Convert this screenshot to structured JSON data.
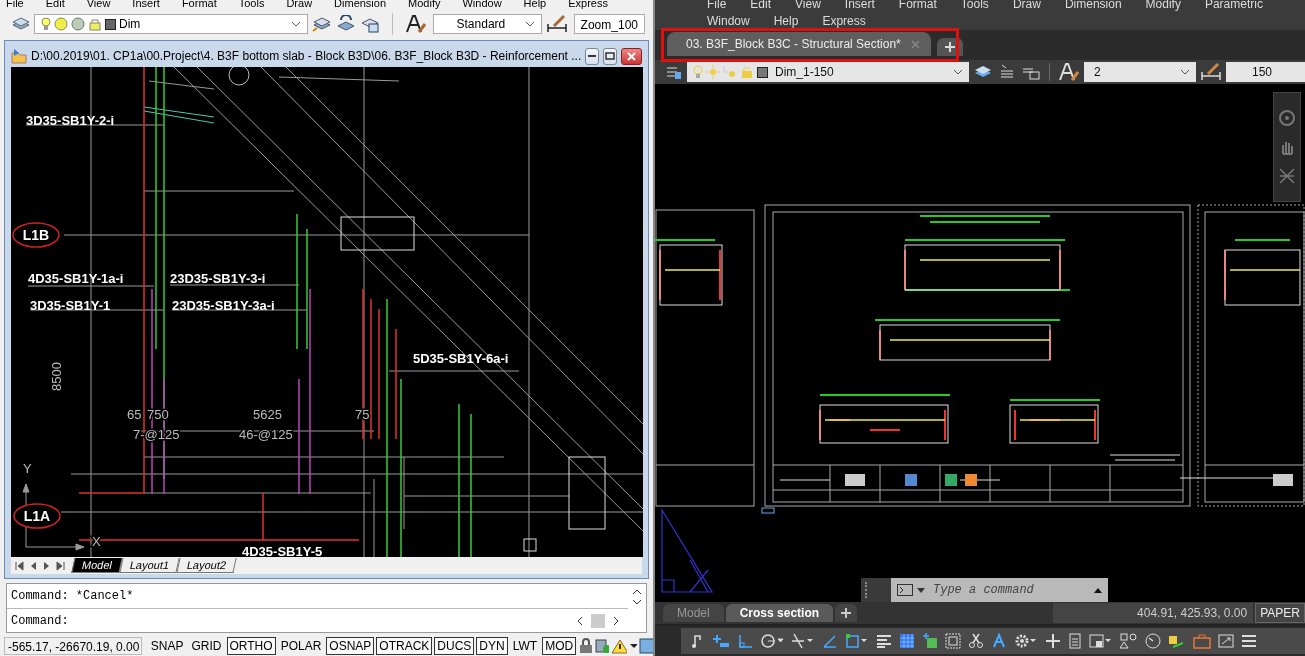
{
  "left_app": {
    "menu": [
      "File",
      "Edit",
      "View",
      "Insert",
      "Format",
      "Tools",
      "Draw",
      "Dimension",
      "Modify",
      "Window",
      "Help",
      "Express"
    ],
    "layer_dropdown": {
      "value": "Dim"
    },
    "text_style_dropdown": {
      "value": "Standard"
    },
    "dimension_style_field": {
      "value": "Zoom_100"
    },
    "document_window": {
      "title": "D:\\00.2019\\01. CP1a\\00.Project\\4. B3F bottom slab - Block B3D\\06.  B3F_Block B3D - Reinforcement ..."
    },
    "drawing_labels": [
      "3D35-SB1Y-2-i",
      "4D35-SB1Y-1a-i",
      "23D35-SB1Y-3-i",
      "3D35-SB1Y-1",
      "23D35-SB1Y-3a-i",
      "5D35-SB1Y-6a-i",
      "4D35-SB1Y-5"
    ],
    "grid_bubbles": [
      "L1B",
      "L1A"
    ],
    "dimension_texts": [
      "8500",
      "65",
      "750",
      "5625",
      "75",
      "7-@125",
      "46-@125"
    ],
    "axis_labels": [
      "Y",
      "X"
    ],
    "layout_tabs": [
      {
        "label": "Model",
        "selected": true
      },
      {
        "label": "Layout1",
        "selected": false
      },
      {
        "label": "Layout2",
        "selected": false
      }
    ],
    "command_history": [
      "Command: *Cancel*",
      "Command:"
    ],
    "coordinates": "-565.17,  -26670.19, 0.00",
    "status_toggles": [
      {
        "label": "SNAP",
        "on": false
      },
      {
        "label": "GRID",
        "on": false
      },
      {
        "label": "ORTHO",
        "on": true
      },
      {
        "label": "POLAR",
        "on": false
      },
      {
        "label": "OSNAP",
        "on": true
      },
      {
        "label": "OTRACK",
        "on": true
      },
      {
        "label": "DUCS",
        "on": true
      },
      {
        "label": "DYN",
        "on": true
      },
      {
        "label": "LWT",
        "on": false
      },
      {
        "label": "MOD",
        "on": true
      }
    ]
  },
  "right_app": {
    "menu_rows": [
      [
        "File",
        "Edit",
        "View",
        "Insert",
        "Format",
        "Tools",
        "Draw",
        "Dimension",
        "Modify",
        "Parametric"
      ],
      [
        "Window",
        "Help",
        "Express"
      ]
    ],
    "file_tabs": [
      {
        "label": "03. B3F_Block B3C - Structural Section*",
        "selected": true
      }
    ],
    "layer_dropdown": {
      "value": "Dim_1-150"
    },
    "text_style_dropdown": {
      "value": "2"
    },
    "dimension_scale_field": {
      "value": "150"
    },
    "command_line": {
      "placeholder": "Type a command"
    },
    "layout_tabs": [
      {
        "label": "Model",
        "selected": false
      },
      {
        "label": "Cross section",
        "selected": true
      }
    ],
    "coordinates": "404.91, 425.93, 0.00",
    "space_button": "PAPER"
  }
}
